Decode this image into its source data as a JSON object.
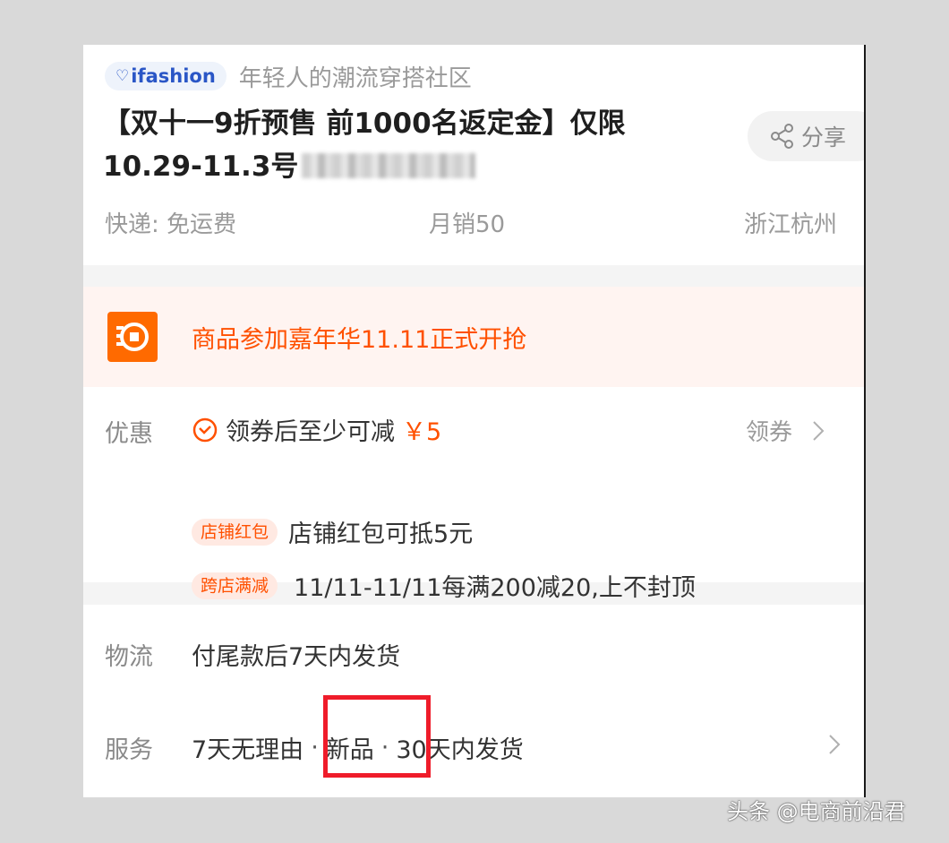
{
  "brand": {
    "name": "ifashion",
    "slogan": "年轻人的潮流穿搭社区"
  },
  "product": {
    "title_line1": "【双十一9折预售 前1000名返定金】仅限",
    "title_line2": "10.29-11.3号"
  },
  "share": {
    "label": "分享"
  },
  "meta": {
    "shipping": "快递: 免运费",
    "monthly_sales": "月销50",
    "location": "浙江杭州"
  },
  "promo_banner": {
    "text": "商品参加嘉年华11.11正式开抢"
  },
  "offers": {
    "label": "优惠",
    "coupon_text": "领券后至少可减",
    "coupon_amount": "￥5",
    "claim_label": "领券",
    "tags": [
      {
        "tag": "店铺红包",
        "text": "店铺红包可抵5元"
      },
      {
        "tag": "跨店满减",
        "text": "11/11-11/11每满200减20,上不封顶"
      }
    ]
  },
  "logistics": {
    "label": "物流",
    "value": "付尾款后7天内发货"
  },
  "service": {
    "label": "服务",
    "items": [
      "7天无理由",
      "新品",
      "30天内发货"
    ]
  },
  "watermark": "头条 @电商前沿君",
  "colors": {
    "accent": "#ff5000",
    "brand_blue": "#2a56c6",
    "highlight_red": "#ef1c2a"
  }
}
